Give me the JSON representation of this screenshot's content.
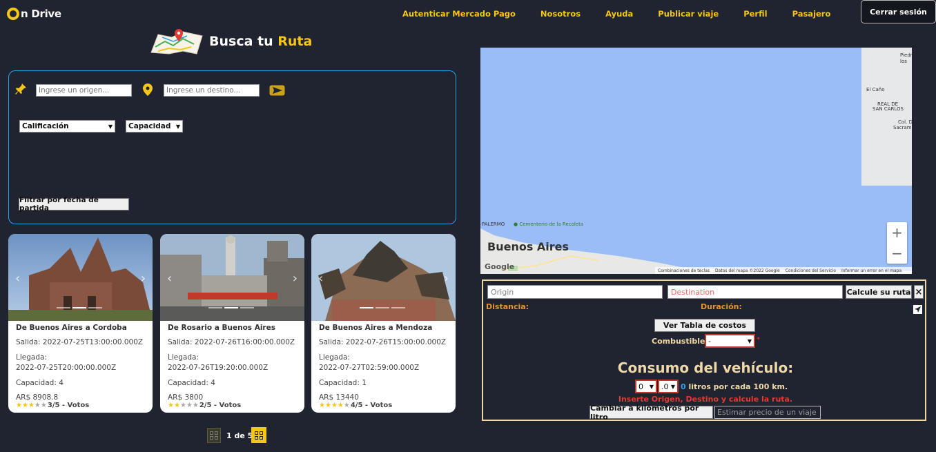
{
  "brand": {
    "logo_prefix": "n",
    "logo_suffix": "Drive"
  },
  "nav": {
    "items": [
      "Autenticar Mercado Pago",
      "Nosotros",
      "Ayuda",
      "Publicar viaje",
      "Perfil",
      "Pasajero"
    ],
    "logout_label": "Cerrar sesión"
  },
  "hero": {
    "title_part1": "Busca tu ",
    "title_part2": "Ruta"
  },
  "search": {
    "origin_placeholder": "Ingrese un origen...",
    "destination_placeholder": "Ingrese un destino...",
    "rating_select": "Calificación",
    "capacity_select": "Capacidad",
    "filter_date_label": "Filtrar por fecha de partida"
  },
  "trips": [
    {
      "route": "De Buenos Aires a Cordoba",
      "departure": "Salida: 2022-07-25T13:00:00.000Z",
      "arrival_label": "Llegada:",
      "arrival": "2022-07-25T20:00:00.000Z",
      "capacity": "Capacidad: 4",
      "price": "AR$ 8908.8",
      "rating": 3,
      "votes": "3/5 - Votos"
    },
    {
      "route": "De Rosario a Buenos Aires",
      "departure": "Salida: 2022-07-26T16:00:00.000Z",
      "arrival_label": "Llegada:",
      "arrival": "2022-07-26T19:20:00.000Z",
      "capacity": "Capacidad: 4",
      "price": "AR$ 3800",
      "rating": 2,
      "votes": "2/5 - Votos"
    },
    {
      "route": "De Buenos Aires a Mendoza",
      "departure": "Salida: 2022-07-26T15:00:00.000Z",
      "arrival_label": "Llegada:",
      "arrival": "2022-07-27T02:59:00.000Z",
      "capacity": "Capacidad: 1",
      "price": "AR$ 13440",
      "rating": 4,
      "votes": "4/5 - Votos"
    }
  ],
  "pagination": {
    "label": "1 de 5"
  },
  "map": {
    "city": "Buenos Aires",
    "labels": {
      "piedras": "Piedr",
      "piedras2": "los",
      "el_cano": "El Caño",
      "real_san_carlos1": "REAL DE",
      "real_san_carlos2": "SAN CARLOS",
      "col_sacram1": "Col. D",
      "col_sacram2": "Sacram",
      "palermo": "PALERMO",
      "cementerio": "Cementerio de la Recoleta"
    },
    "attribution": [
      "Combinaciones de teclas",
      "Datos del mapa ©2022 Google",
      "Condiciones del Servicio",
      "Informar un error en el mapa"
    ],
    "google": "Google",
    "zoom_in": "+",
    "zoom_out": "−"
  },
  "calculator": {
    "origin_placeholder": "Origin",
    "destination_placeholder": "Destination",
    "calc_button": "Calcule su ruta",
    "close_button": "×",
    "distance_label": "Distancia:",
    "duration_label": "Duración:",
    "cost_table_button": "Ver Tabla de costos",
    "fuel_label": "Combustible",
    "fuel_value": "-",
    "fuel_required": "*",
    "title": "Consumo del vehículo:",
    "consumption_int": "0",
    "consumption_dec": ".0",
    "liters_value": "0",
    "liters_text": " litros por cada 100 km.",
    "error": "Inserte Origen, Destino y calcule la ruta.",
    "km_button": "Cambiar a kilómetros por litro",
    "estimate_placeholder": "Estimar precio de un viaje"
  },
  "colors": {
    "accent": "#f5c518",
    "panel_border": "#2ea0e6",
    "calc_border": "#f0d9a8",
    "error": "#e53935",
    "label": "#e8942c"
  }
}
